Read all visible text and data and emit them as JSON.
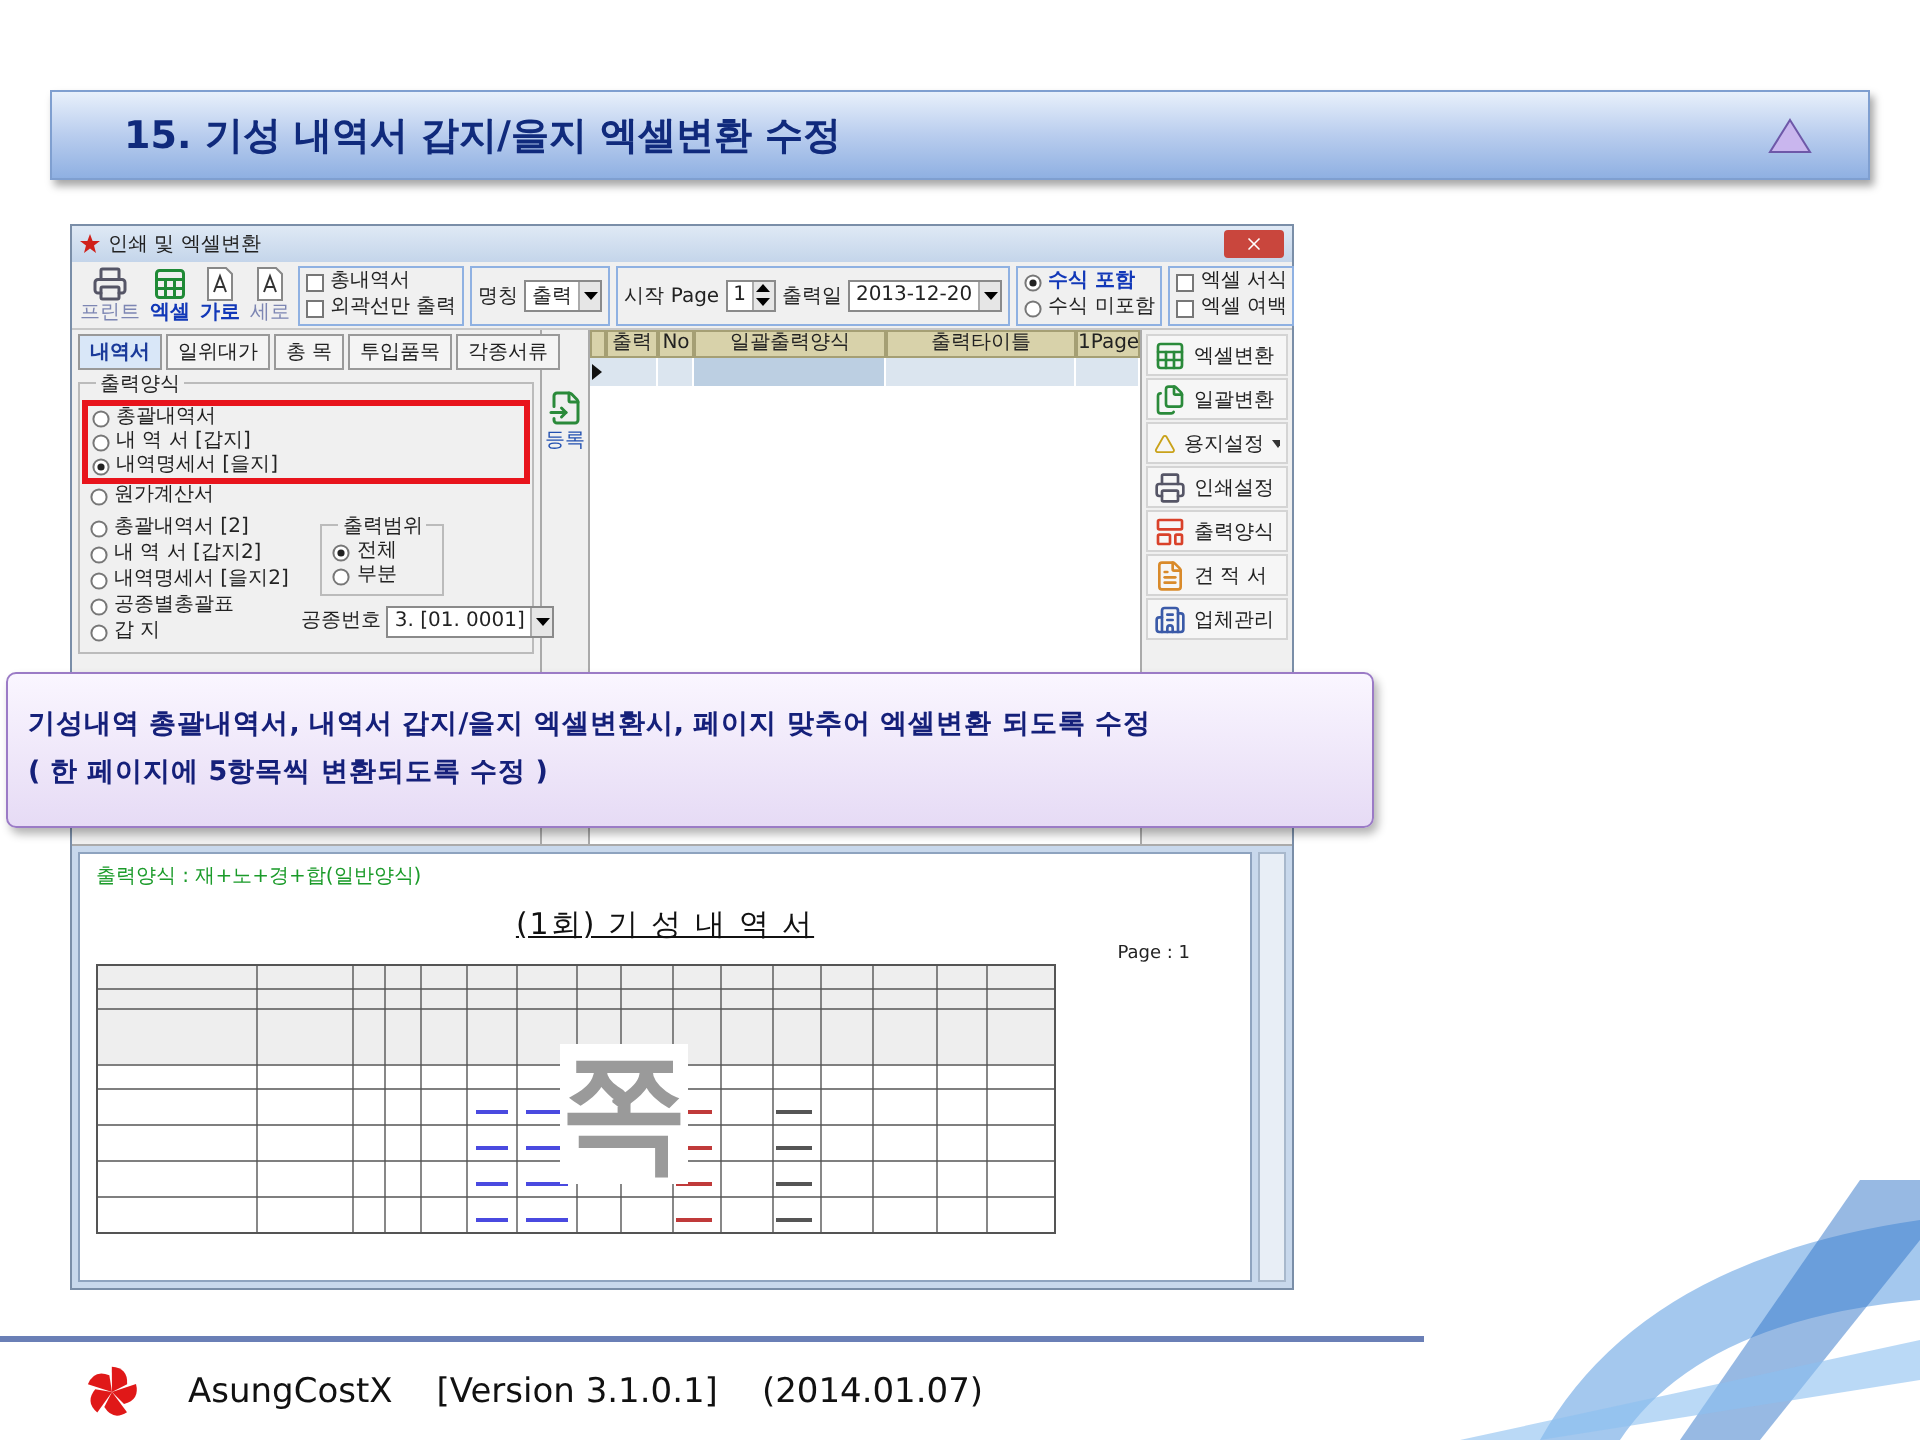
{
  "slide_title": "15. 기성 내역서 갑지/을지 엑셀변환 수정",
  "window": {
    "title": "인쇄 및 엑셀변환"
  },
  "toolbar": {
    "buttons": [
      {
        "label": "프린트",
        "kind": "print",
        "selected": false
      },
      {
        "label": "엑셀",
        "kind": "excel",
        "selected": true
      },
      {
        "label": "가로",
        "kind": "landscape",
        "selected": true
      },
      {
        "label": "세로",
        "kind": "portrait",
        "selected": false
      }
    ],
    "options": [
      {
        "label": "총내역서",
        "checked": false
      },
      {
        "label": "외곽선만 출력",
        "checked": false
      }
    ],
    "name_field": {
      "label": "명칭",
      "value": "출력"
    },
    "start_page": {
      "label": "시작 Page",
      "value": "1"
    },
    "output_date": {
      "label": "출력일",
      "value": "2013-12-20"
    },
    "formula": [
      {
        "label": "수식 포함",
        "selected": true
      },
      {
        "label": "수식 미포함",
        "selected": false
      }
    ],
    "excel_options": [
      {
        "label": "엑셀 서식",
        "checked": false
      },
      {
        "label": "엑셀 여백",
        "checked": false
      }
    ]
  },
  "tabs": [
    {
      "label": "내역서",
      "selected": true
    },
    {
      "label": "일위대가",
      "selected": false
    },
    {
      "label": "총 목",
      "selected": false
    },
    {
      "label": "투입품목",
      "selected": false
    },
    {
      "label": "각종서류",
      "selected": false
    }
  ],
  "output_format": {
    "title": "출력양식",
    "highlighted": [
      {
        "label": "총괄내역서",
        "selected": false
      },
      {
        "label": "내 역 서 [갑지]",
        "selected": false
      },
      {
        "label": "내역명세서 [을지]",
        "selected": true
      }
    ],
    "others": [
      {
        "label": "원가계산서",
        "selected": false
      }
    ],
    "set_2": [
      {
        "label": "총괄내역서 [2]",
        "selected": false
      },
      {
        "label": "내 역 서 [갑지2]",
        "selected": false
      },
      {
        "label": "내역명세서 [을지2]",
        "selected": false
      },
      {
        "label": "공종별총괄표",
        "selected": false
      },
      {
        "label": "갑 지",
        "selected": false
      }
    ]
  },
  "output_range": {
    "title": "출력범위",
    "options": [
      {
        "label": "전체",
        "selected": true
      },
      {
        "label": "부분",
        "selected": false
      }
    ]
  },
  "work_number": {
    "label": "공종번호",
    "value": "3. [01. 0001]"
  },
  "register_button": "등록",
  "grid": {
    "columns": [
      "출력",
      "No",
      "일괄출력양식",
      "출력타이틀",
      "1Page"
    ]
  },
  "side_buttons": [
    {
      "label": "엑셀변환",
      "kind": "excel",
      "has_menu": false
    },
    {
      "label": "일괄변환",
      "kind": "batch",
      "has_menu": false
    },
    {
      "label": "용지설정",
      "kind": "paper",
      "has_menu": true
    },
    {
      "label": "인쇄설정",
      "kind": "print",
      "has_menu": false
    },
    {
      "label": "출력양식",
      "kind": "format",
      "has_menu": false
    },
    {
      "label": "견 적 서",
      "kind": "estimate",
      "has_menu": false
    },
    {
      "label": "업체관리",
      "kind": "company",
      "has_menu": false
    }
  ],
  "preview": {
    "format_line": "출력양식 : 재+노+경+합(일반양식)",
    "title": "(1회) 기 성 내 역 서",
    "page": "Page : 1",
    "overlay_char": "쪽"
  },
  "callout": {
    "lines": [
      "기성내역 총괄내역서, 내역서 갑지/을지 엑셀변환시, 페이지 맞추어 엑셀변환 되도록 수정",
      "( 한 페이지에 5항목씩 변환되도록 수정 )"
    ]
  },
  "footer": {
    "product": "AsungCostX",
    "version": "[Version 3.1.0.1]",
    "date": "(2014.01.07)"
  }
}
